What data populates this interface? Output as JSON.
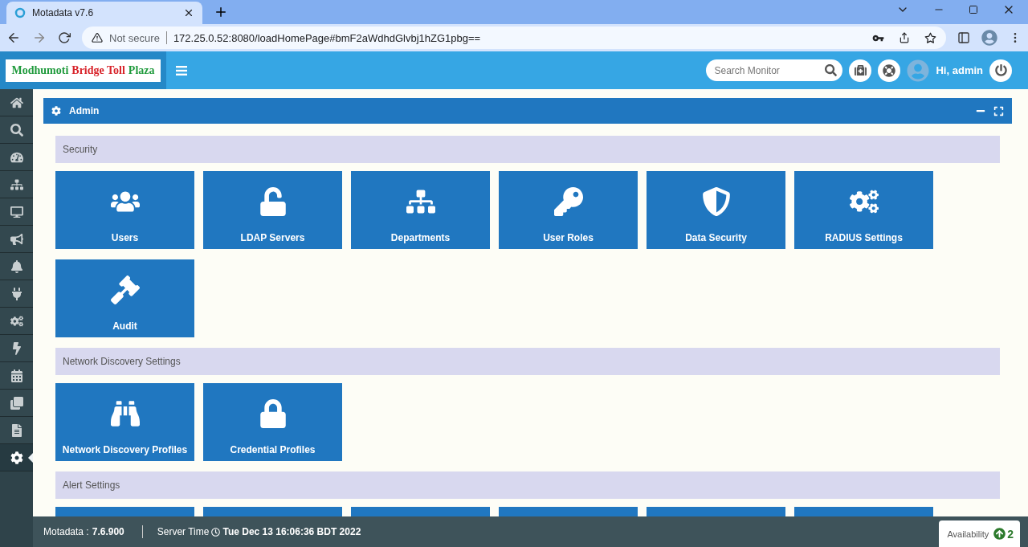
{
  "browser": {
    "tab_title": "Motadata v7.6",
    "security": "Not secure",
    "url": "172.25.0.52:8080/loadHomePage#bmF2aWdhdGlvbj1hZG1pbg=="
  },
  "header": {
    "logo": [
      {
        "text": "Modhumoti",
        "color": "#1f9a3c"
      },
      {
        "text": "Bridge Toll",
        "color": "#d8232a"
      },
      {
        "text": "Plaza",
        "color": "#1f9a3c"
      }
    ],
    "search": {
      "placeholder": "Search Monitor"
    },
    "greeting": "Hi, admin"
  },
  "sidebar": {
    "items": [
      {
        "selected": false
      },
      {
        "selected": false
      },
      {
        "selected": false
      },
      {
        "selected": false
      },
      {
        "selected": false
      },
      {
        "selected": false
      },
      {
        "selected": false
      },
      {
        "selected": false
      },
      {
        "selected": false
      },
      {
        "selected": false
      },
      {
        "selected": false
      },
      {
        "selected": false
      },
      {
        "selected": false
      },
      {
        "selected": true
      }
    ]
  },
  "panel": {
    "title": "Admin",
    "sections": [
      {
        "title": "Security",
        "tiles": [
          {
            "kind": "tile",
            "label": "Users"
          },
          {
            "kind": "tile",
            "label": "LDAP Servers"
          },
          {
            "kind": "tile",
            "label": "Departments"
          },
          {
            "kind": "tile",
            "label": "User Roles"
          },
          {
            "kind": "tile",
            "label": "Data Security"
          },
          {
            "kind": "tile",
            "label": "RADIUS Settings"
          },
          {
            "kind": "tile",
            "label": "Audit"
          }
        ]
      },
      {
        "title": "Network Discovery Settings",
        "tiles": [
          {
            "kind": "tile",
            "label": "Network Discovery Profiles"
          },
          {
            "kind": "tile",
            "label": "Credential Profiles"
          }
        ]
      },
      {
        "title": "Alert Settings",
        "tiles": [
          {
            "kind": "cut"
          },
          {
            "kind": "cut"
          },
          {
            "kind": "cut"
          },
          {
            "kind": "cut"
          },
          {
            "kind": "cut"
          },
          {
            "kind": "cut"
          }
        ]
      }
    ]
  },
  "status_bar": {
    "product_label": "Motadata :",
    "version": "7.6.900",
    "time_label": "Server Time",
    "time": "Tue Dec 13 16:06:36 BDT 2022",
    "availability_label": "Availability",
    "availability_count": "2"
  }
}
